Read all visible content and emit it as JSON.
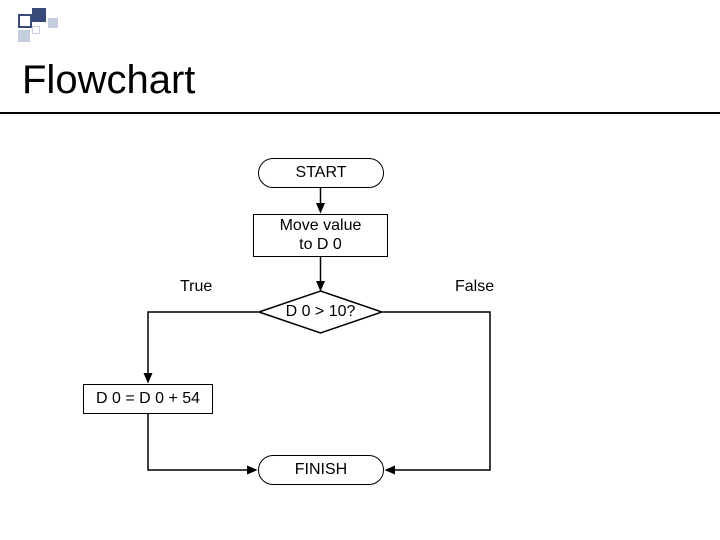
{
  "title": "Flowchart",
  "nodes": {
    "start": "START",
    "move": "Move value\nto D 0",
    "decision": "D 0 > 10?",
    "process_true": "D 0 = D 0 + 54",
    "finish": "FINISH"
  },
  "labels": {
    "true": "True",
    "false": "False"
  },
  "decor_colors": {
    "dark": "#3a4a7a",
    "light": "#c5cde0"
  }
}
